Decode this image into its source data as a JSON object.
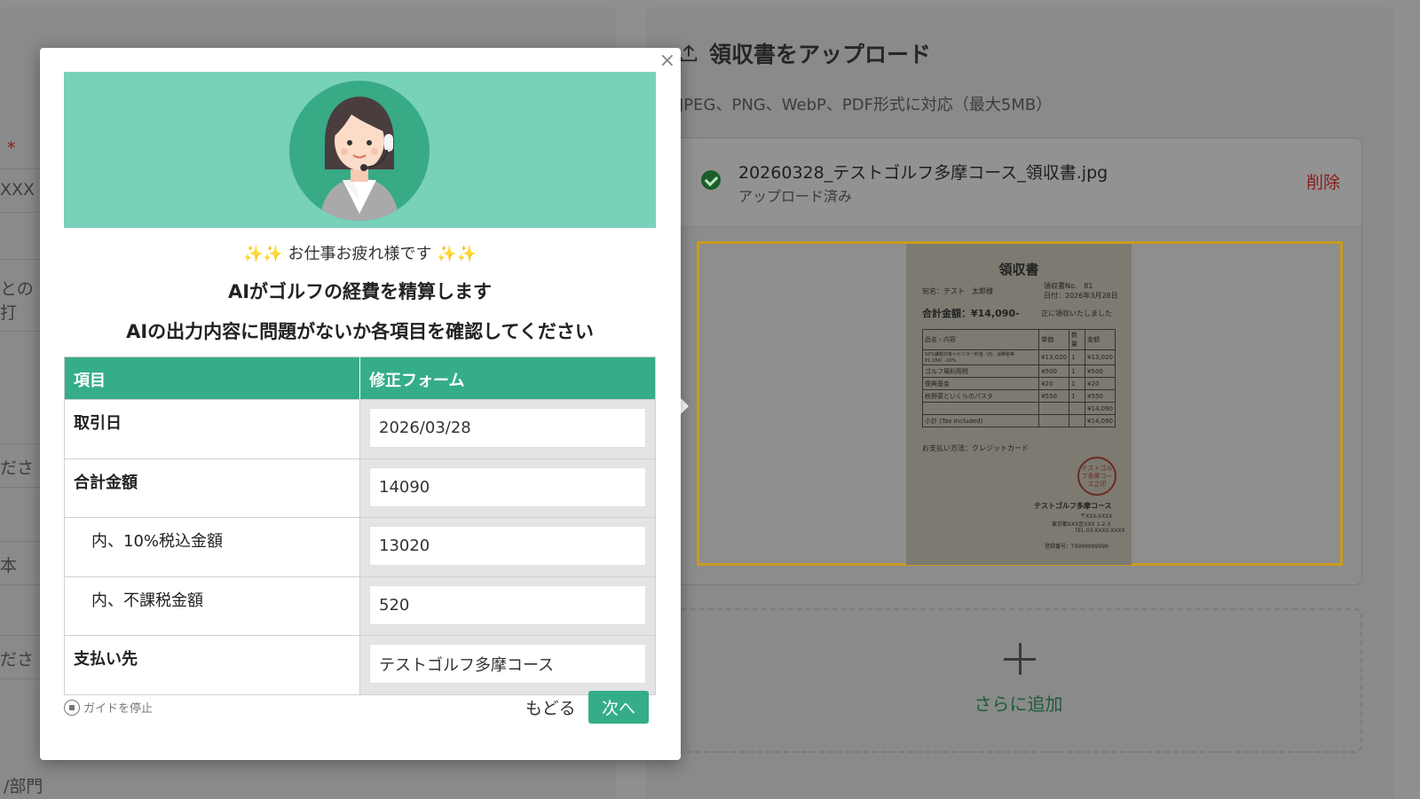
{
  "background_form": {
    "required_mark": "*",
    "field_fragment_1": "XXX",
    "field_fragment_2": "との打",
    "field_fragment_3": "ださ",
    "field_fragment_4": "本",
    "field_fragment_5": "ださ",
    "bottom_label": "/部門"
  },
  "upload": {
    "title": "領収書をアップロード",
    "subtitle": "JPEG、PNG、WebP、PDF形式に対応（最大5MB）",
    "file_name": "20260328_テストゴルフ多摩コース_領収書.jpg",
    "file_status": "アップロード済み",
    "delete_label": "削除",
    "add_more_label": "さらに追加"
  },
  "receipt": {
    "title": "領収書",
    "addressee": "宛名：テスト　太郎様",
    "receipt_no": "領収書No.　81",
    "date": "日付：2026年3月28日",
    "total": "合計金額：¥14,090-",
    "received": "正に領収いたしました",
    "headers": [
      "品名・内容",
      "単価",
      "数量",
      "金額"
    ],
    "rows": [
      [
        "10%課税対象＝ビジター料金（内、消費税等　¥1,184）-10%",
        "¥13,020",
        "1",
        "¥13,020"
      ],
      [
        "ゴルフ場利用税",
        "¥500",
        "1",
        "¥500"
      ],
      [
        "復興基金",
        "¥20",
        "1",
        "¥20"
      ],
      [
        "秋野菜といくらのパスタ",
        "¥550",
        "1",
        "¥550"
      ],
      [
        "",
        "",
        "",
        "¥14,090"
      ],
      [
        "小計 (Tax Included)",
        "",
        "",
        "¥14,090"
      ]
    ],
    "payment": "お支払い方法：クレジットカード",
    "stamp": "テストゴルフ多摩コース之印",
    "company": "テストゴルフ多摩コース",
    "postal": "〒XXX-XXXX",
    "address": "東京都XXX区XXX 1-2-3",
    "tel": "TEL 03-XXXX-XXXX",
    "reg_no": "登録番号：T9999999999"
  },
  "guide": {
    "close": "×",
    "greeting": "✨✨ お仕事お疲れ様です ✨✨",
    "headline": "AIがゴルフの経費を精算します",
    "instruction": "AIの出力内容に問題がないか各項目を確認してください",
    "col_item": "項目",
    "col_form": "修正フォーム",
    "rows": [
      {
        "label": "取引日",
        "value": "2026/03/28"
      },
      {
        "label": "合計金額",
        "value": "14090"
      },
      {
        "label": "内、10%税込金額",
        "value": "13020"
      },
      {
        "label": "内、不課税金額",
        "value": "520"
      },
      {
        "label": "支払い先",
        "value": "テストゴルフ多摩コース"
      }
    ],
    "stop_label": "ガイドを停止",
    "back_label": "もどる",
    "next_label": "次へ"
  },
  "colors": {
    "accent": "#35ad88",
    "banner": "#78d1b9",
    "delete": "#8c1b1b",
    "preview_border": "#c99c1e"
  }
}
